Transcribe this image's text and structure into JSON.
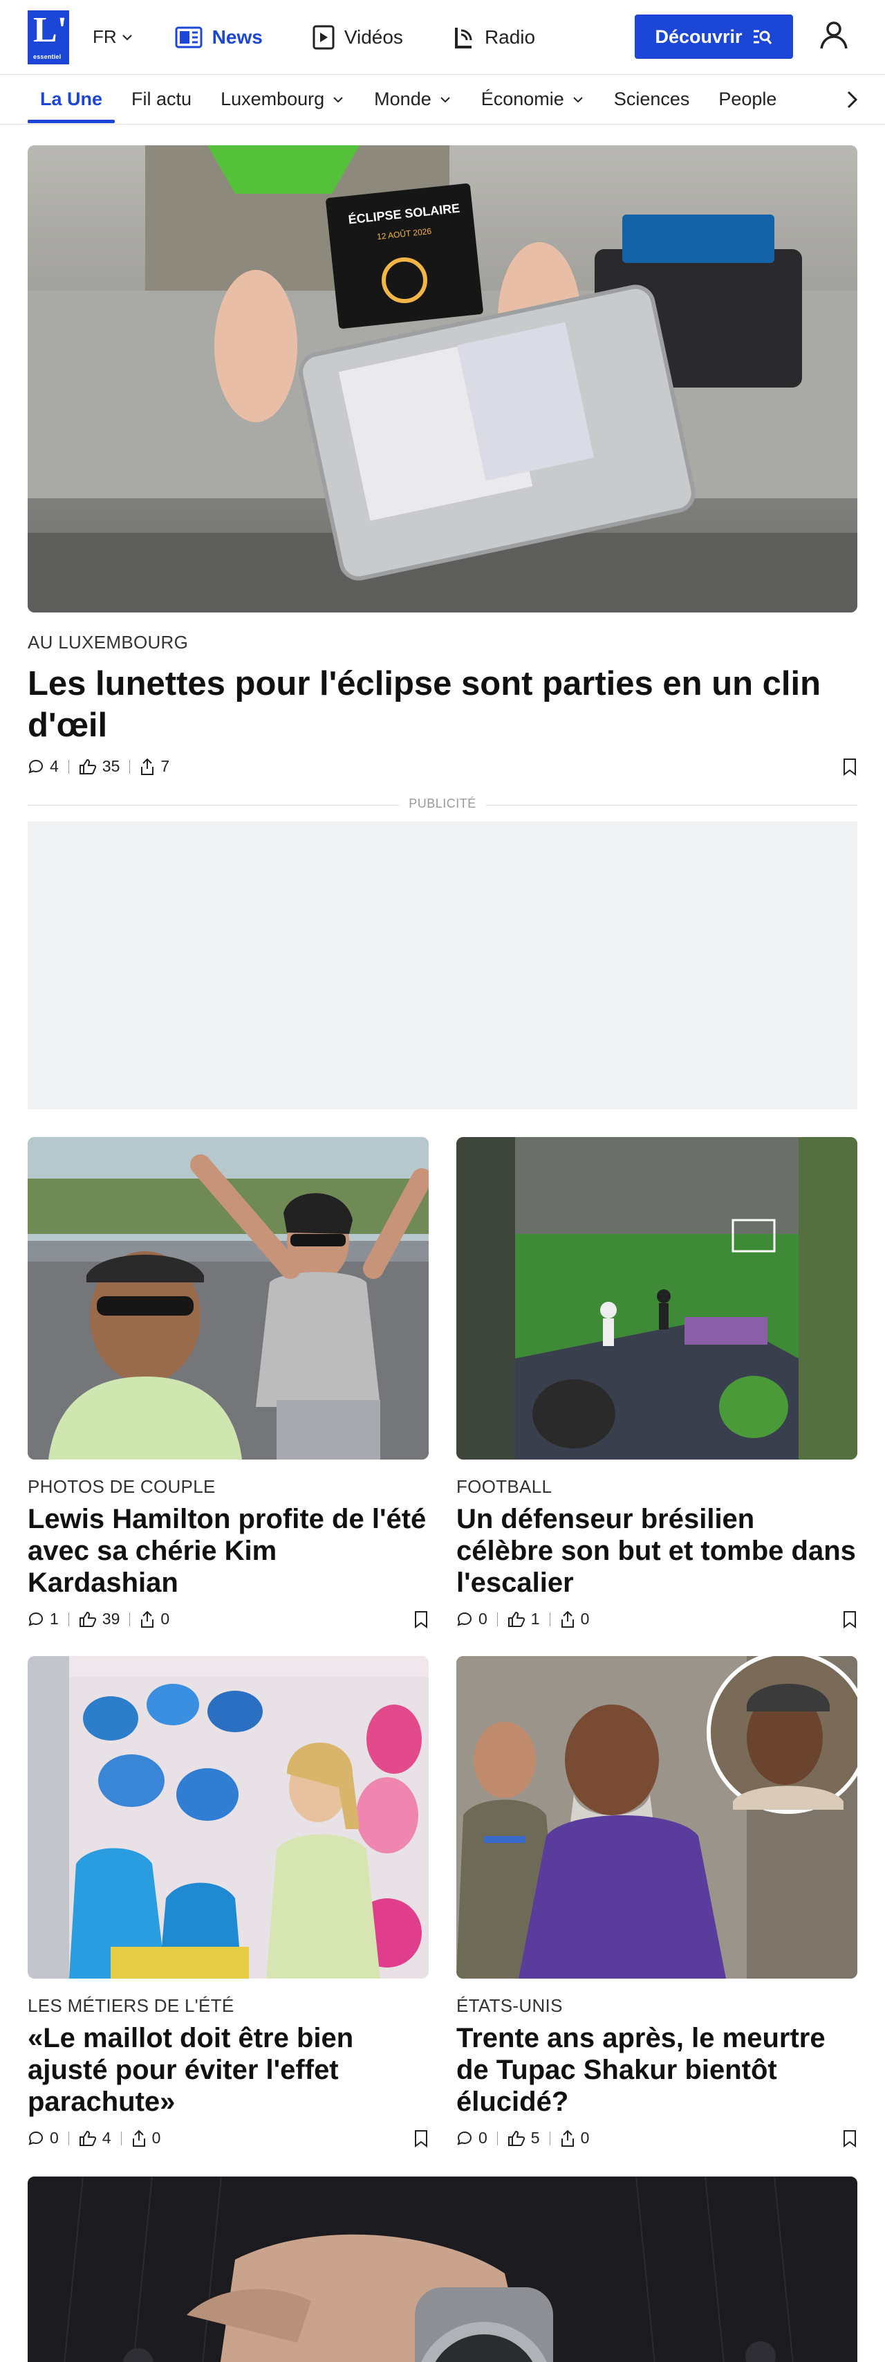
{
  "header": {
    "logo_big": "L'",
    "logo_small": "essentiel",
    "lang": "FR",
    "nav": [
      {
        "label": "News",
        "icon": "news-icon",
        "active": true
      },
      {
        "label": "Vidéos",
        "icon": "video-icon"
      },
      {
        "label": "Radio",
        "icon": "radio-icon"
      }
    ],
    "discover_label": "Découvrir",
    "brand_color": "#1c47d6"
  },
  "sections": [
    {
      "label": "La Une",
      "active": true
    },
    {
      "label": "Fil actu"
    },
    {
      "label": "Luxembourg",
      "dropdown": true
    },
    {
      "label": "Monde",
      "dropdown": true
    },
    {
      "label": "Économie",
      "dropdown": true
    },
    {
      "label": "Sciences"
    },
    {
      "label": "People"
    }
  ],
  "hero": {
    "kicker": "AU LUXEMBOURG",
    "title": "Les lunettes pour l'éclipse sont parties en un clin d'œil",
    "comments": "4",
    "likes": "35",
    "shares": "7",
    "image_sign_line1": "ÉCLIPSE SOLAIRE",
    "image_sign_line2": "12 AOÛT 2026"
  },
  "ad_label": "PUBLICITÉ",
  "articles": [
    {
      "kicker": "PHOTOS DE COUPLE",
      "title": "Lewis Hamilton profite de l'été avec sa chérie Kim Kardashian",
      "comments": "1",
      "likes": "39",
      "shares": "0"
    },
    {
      "kicker": "FOOTBALL",
      "title": "Un défenseur brésilien célèbre son but et tombe dans l'escalier",
      "comments": "0",
      "likes": "1",
      "shares": "0"
    },
    {
      "kicker": "LES MÉTIERS DE L'ÉTÉ",
      "title": "«Le maillot doit être bien ajusté pour éviter l'effet parachute»",
      "comments": "0",
      "likes": "4",
      "shares": "0"
    },
    {
      "kicker": "ÉTATS-UNIS",
      "title": "Trente ans après, le meurtre de Tupac Shakur bientôt élucidé?",
      "comments": "0",
      "likes": "5",
      "shares": "0"
    }
  ]
}
